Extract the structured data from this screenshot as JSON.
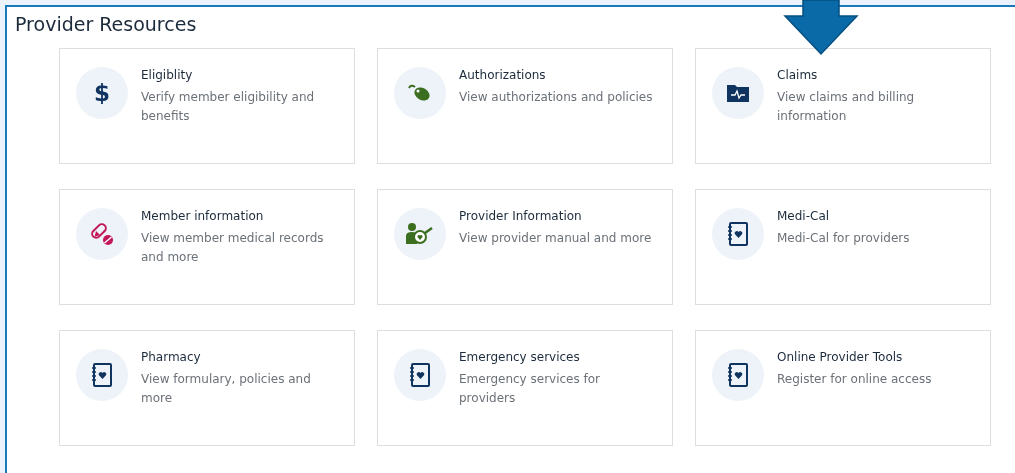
{
  "title": "Provider Resources",
  "cards": [
    {
      "kind": "dollar",
      "symbol": "$",
      "title": "Eligiblity",
      "description": "Verify member eligibility and benefits"
    },
    {
      "kind": "mouse",
      "title": "Authorizations",
      "description": "View authorizations and policies"
    },
    {
      "kind": "folder",
      "title": "Claims",
      "description": "View claims and billing information"
    },
    {
      "kind": "pills",
      "title": "Member information",
      "description": "View member medical records and more"
    },
    {
      "kind": "person",
      "title": "Provider Information",
      "description": "View provider manual and more"
    },
    {
      "kind": "notebook",
      "title": "Medi-Cal",
      "description": "Medi-Cal for providers"
    },
    {
      "kind": "notebook",
      "title": "Pharmacy",
      "description": "View formulary, policies and more"
    },
    {
      "kind": "notebook",
      "title": "Emergency services",
      "description": "Emergency services for providers"
    },
    {
      "kind": "notebook",
      "title": "Online Provider Tools",
      "description": "Register for online access"
    }
  ]
}
